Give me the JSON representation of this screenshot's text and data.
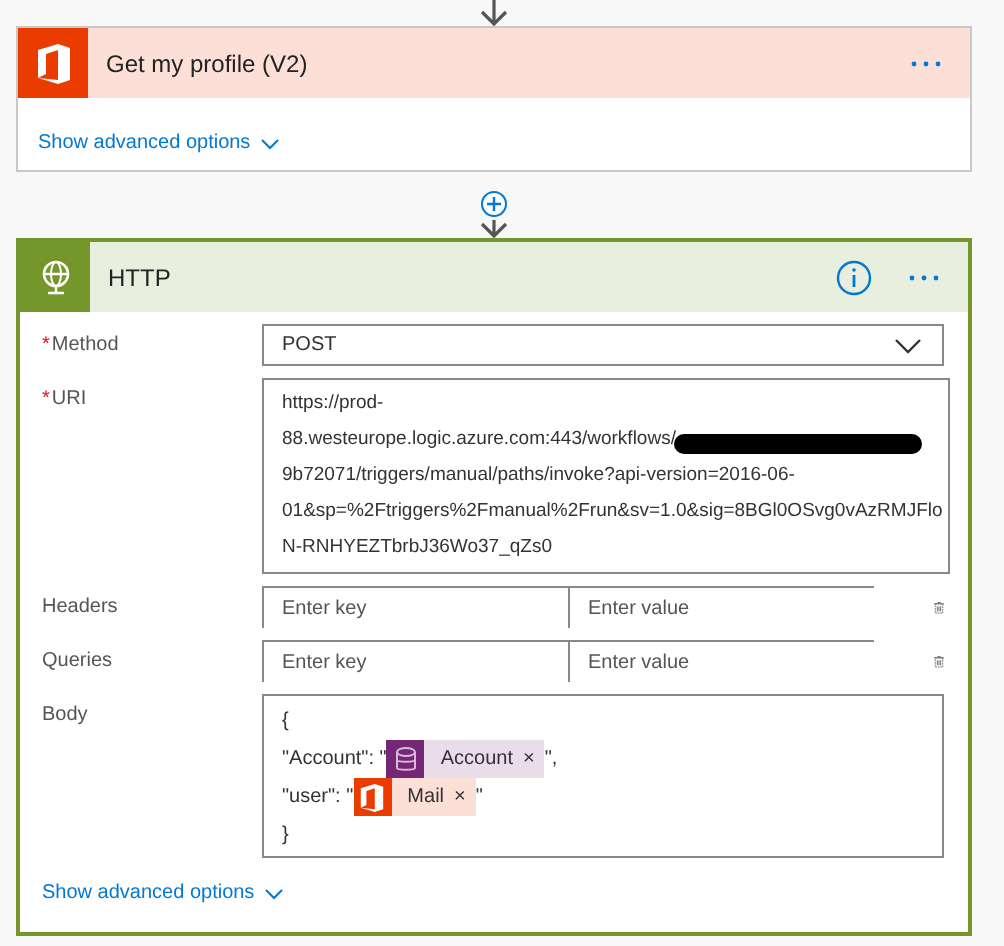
{
  "profile_card": {
    "title": "Get my profile (V2)",
    "advanced_link": "Show advanced options"
  },
  "http_card": {
    "title": "HTTP",
    "method": {
      "label": "Method",
      "required_mark": "*",
      "value": "POST"
    },
    "uri": {
      "label": "URI",
      "required_mark": "*",
      "lines": [
        "https://prod-",
        "88.westeurope.logic.azure.com:443/workflows/",
        "9b72071/triggers/manual/paths/invoke?api-version=2016-06-",
        "01&sp=%2Ftriggers%2Fmanual%2Frun&sv=1.0&sig=8BGl0OSvg0vAzRMJFlo",
        "N-RNHYEZTbrbJ36Wo37_qZs0"
      ]
    },
    "kv_rows": [
      {
        "label": "Headers",
        "key_placeholder": "Enter key",
        "value_placeholder": "Enter value"
      },
      {
        "label": "Queries",
        "key_placeholder": "Enter key",
        "value_placeholder": "Enter value"
      }
    ],
    "body": {
      "label": "Body",
      "lines": [
        {
          "parts": [
            {
              "kind": "text",
              "text": "{"
            }
          ]
        },
        {
          "parts": [
            {
              "kind": "text",
              "text": "\"Account\": \""
            },
            {
              "kind": "database",
              "text": "Account",
              "remove": "×"
            },
            {
              "kind": "text",
              "text": "\","
            }
          ]
        },
        {
          "parts": [
            {
              "kind": "text",
              "text": "\"user\": \""
            },
            {
              "kind": "office",
              "text": "Mail",
              "remove": "×"
            },
            {
              "kind": "text",
              "text": "\""
            }
          ]
        },
        {
          "parts": [
            {
              "kind": "text",
              "text": "}"
            }
          ]
        }
      ]
    },
    "advanced_link": "Show advanced options"
  }
}
